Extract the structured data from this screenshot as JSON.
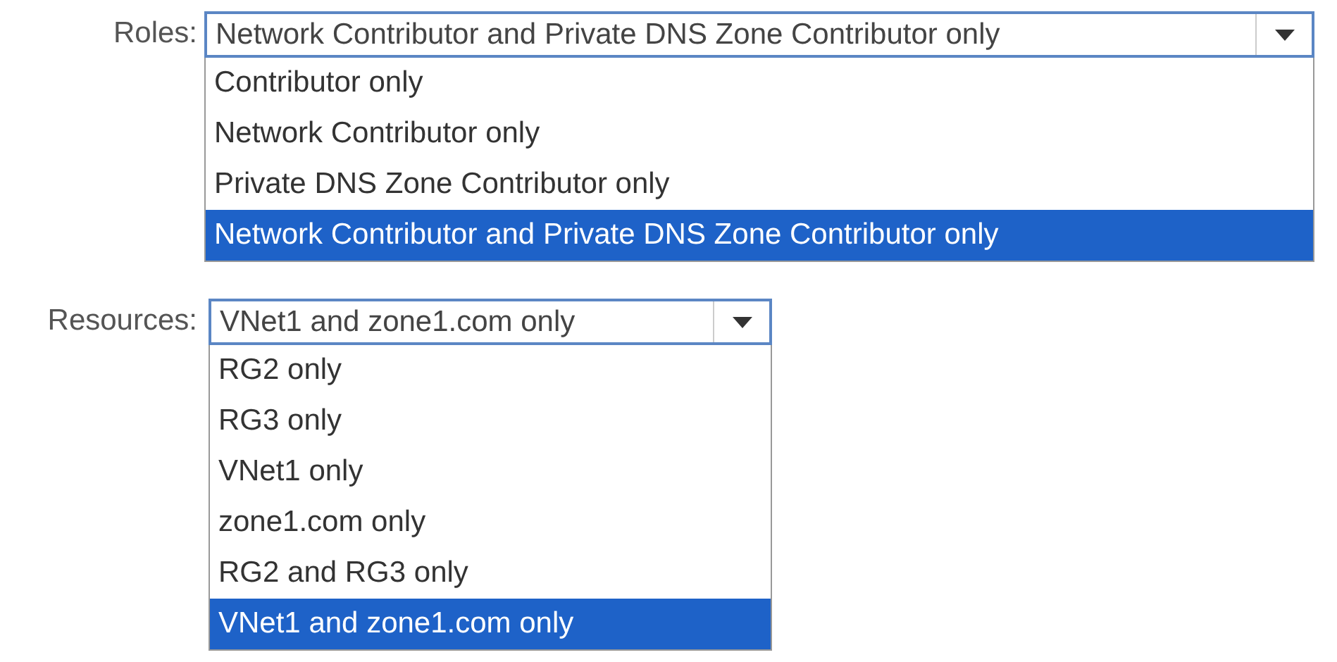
{
  "fields": [
    {
      "label": "Roles:",
      "value": "Network Contributor and Private DNS Zone Contributor only",
      "expanded": true,
      "options": [
        {
          "label": "Contributor only",
          "selected": false
        },
        {
          "label": "Network Contributor only",
          "selected": false
        },
        {
          "label": "Private DNS Zone Contributor only",
          "selected": false
        },
        {
          "label": "Network Contributor and Private DNS Zone Contributor only",
          "selected": true
        }
      ]
    },
    {
      "label": "Resources:",
      "value": "VNet1 and zone1.com only",
      "expanded": true,
      "options": [
        {
          "label": "RG2 only",
          "selected": false
        },
        {
          "label": "RG3 only",
          "selected": false
        },
        {
          "label": "VNet1 only",
          "selected": false
        },
        {
          "label": "zone1.com only",
          "selected": false
        },
        {
          "label": "RG2 and RG3 only",
          "selected": false
        },
        {
          "label": "VNet1 and zone1.com only",
          "selected": true
        }
      ]
    }
  ]
}
